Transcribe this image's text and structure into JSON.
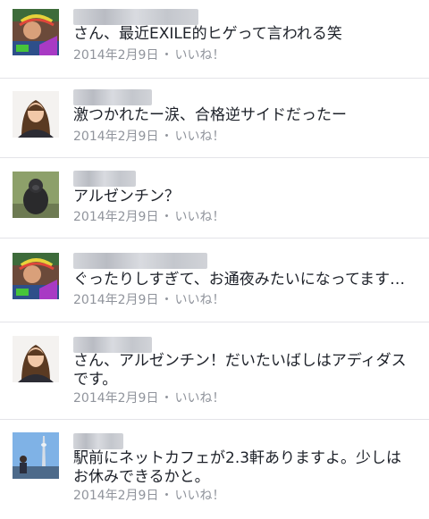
{
  "comments": [
    {
      "author": "",
      "avatar": "rainbow-photo-avatar",
      "text": "さん、最近EXILE的ヒゲって言われる笑",
      "date": "2014年2月9日",
      "separator": "・",
      "like": "いいね！"
    },
    {
      "author": "",
      "avatar": "woman-portrait-avatar",
      "text": "激つかれたー涙、合格逆サイドだったー",
      "date": "2014年2月9日",
      "separator": "・",
      "like": "いいね！"
    },
    {
      "author": "",
      "avatar": "gorilla-photo-avatar",
      "text": "アルゼンチン？",
      "date": "2014年2月9日",
      "separator": "・",
      "like": "いいね！"
    },
    {
      "author": "",
      "avatar": "rainbow-photo-avatar",
      "text": "ぐったりしすぎて、お通夜みたいになってます…",
      "date": "2014年2月9日",
      "separator": "・",
      "like": "いいね！"
    },
    {
      "author": "",
      "avatar": "woman-portrait-avatar",
      "text": "さん、アルゼンチン！だいたいばしはアディダスです。",
      "date": "2014年2月9日",
      "separator": "・",
      "like": "いいね！"
    },
    {
      "author": "",
      "avatar": "tower-photo-avatar",
      "text": "駅前にネットカフェが2.3軒ありますよ。少しはお休みできるかと。",
      "date": "2014年2月9日",
      "separator": "・",
      "like": "いいね！"
    }
  ],
  "colors": {
    "text": "#1d2129",
    "meta": "#90949c",
    "divider": "#e3e4e8"
  }
}
